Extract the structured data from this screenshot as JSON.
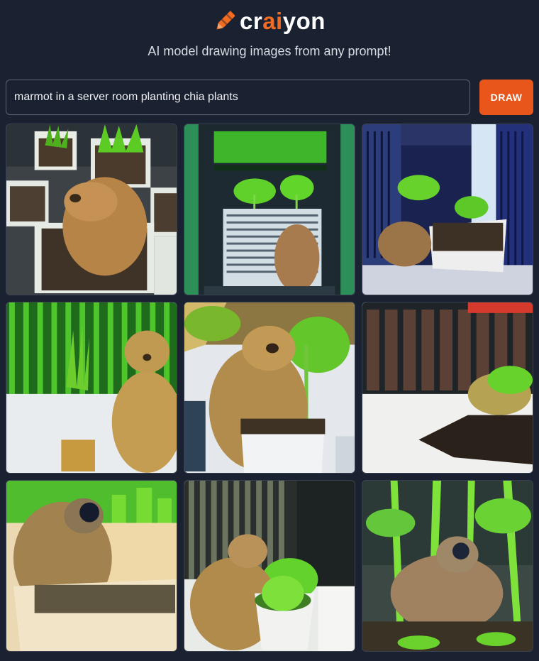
{
  "brand": {
    "prefix": "cr",
    "accent": "ai",
    "suffix": "yon",
    "accent_color": "#f26b21",
    "icon": "crayon-icon"
  },
  "subtitle": "AI model drawing images from any prompt!",
  "prompt": {
    "value": "marmot in a server room planting chia plants",
    "placeholder": ""
  },
  "draw_button": {
    "label": "DRAW",
    "color": "#e8561c"
  },
  "results": {
    "count": 9,
    "descriptions": [
      "marmot sitting among potted seedlings on a server rack floor",
      "marmot in front of server rack with green sprouts",
      "chia plant in tray in a server aisle with marmot",
      "marmot standing beside green server cabinet with plant pot",
      "marmot holding potted plant in server room",
      "marmot behind soil pile in white server room",
      "marmot in a soil planter with green sprouts",
      "marmot next to white pot of green plants between racks",
      "marmot under tall green chia stalks"
    ]
  }
}
